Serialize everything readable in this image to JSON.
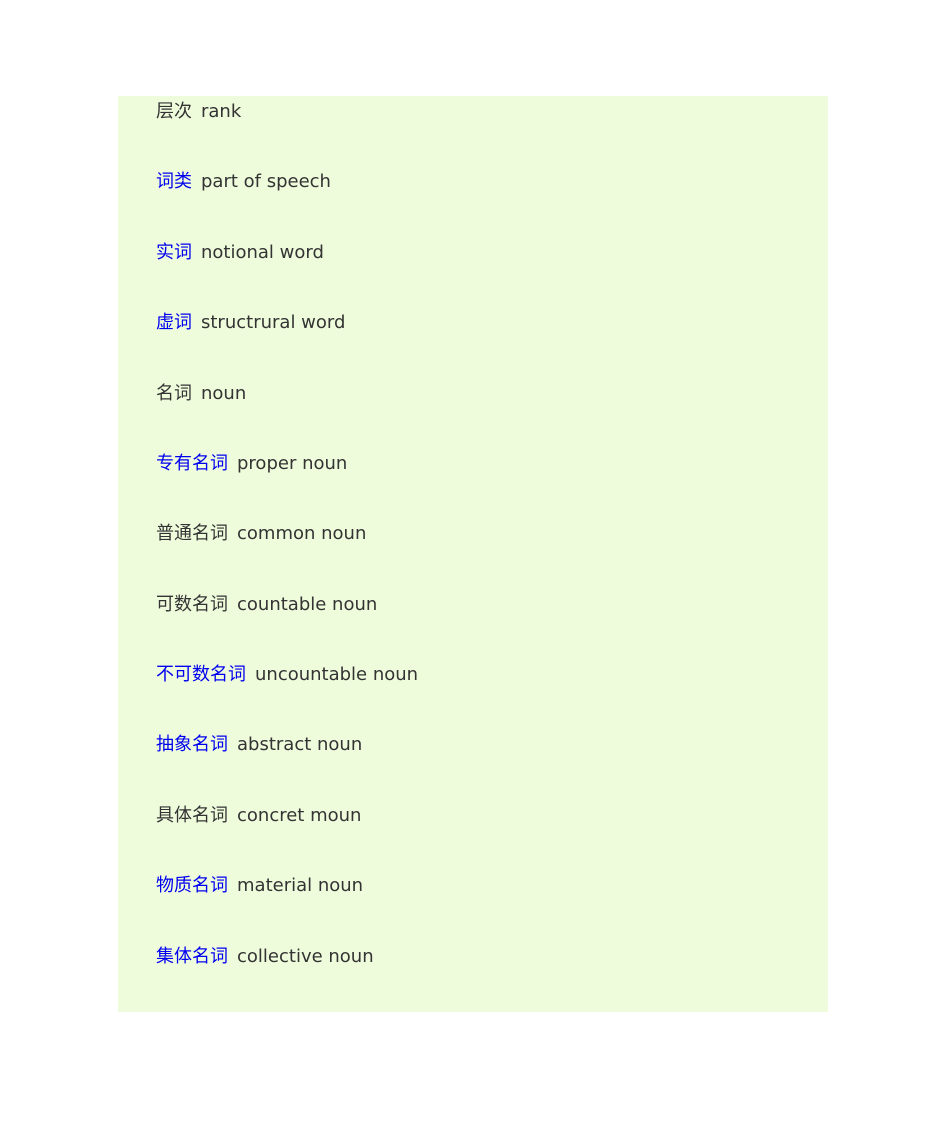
{
  "terms": [
    {
      "zh": "层次",
      "en": "rank",
      "link": false
    },
    {
      "zh": "词类",
      "en": "part of speech",
      "link": true
    },
    {
      "zh": "实词",
      "en": "notional word",
      "link": true
    },
    {
      "zh": "虚词",
      "en": "structrural word",
      "link": true
    },
    {
      "zh": "名词",
      "en": "noun",
      "link": false
    },
    {
      "zh": "专有名词",
      "en": "proper noun",
      "link": true
    },
    {
      "zh": "普通名词",
      "en": "common noun",
      "link": false
    },
    {
      "zh": "可数名词",
      "en": "countable noun",
      "link": false
    },
    {
      "zh": "不可数名词",
      "en": "uncountable noun",
      "link": true
    },
    {
      "zh": "抽象名词",
      "en": "abstract noun",
      "link": true
    },
    {
      "zh": "具体名词",
      "en": "concret moun",
      "link": false
    },
    {
      "zh": "物质名词",
      "en": "material noun",
      "link": true
    },
    {
      "zh": "集体名词",
      "en": "collective noun",
      "link": true
    }
  ],
  "colors": {
    "link": "#0000ee",
    "text": "#333333",
    "panel_bg": "#effcdc"
  }
}
